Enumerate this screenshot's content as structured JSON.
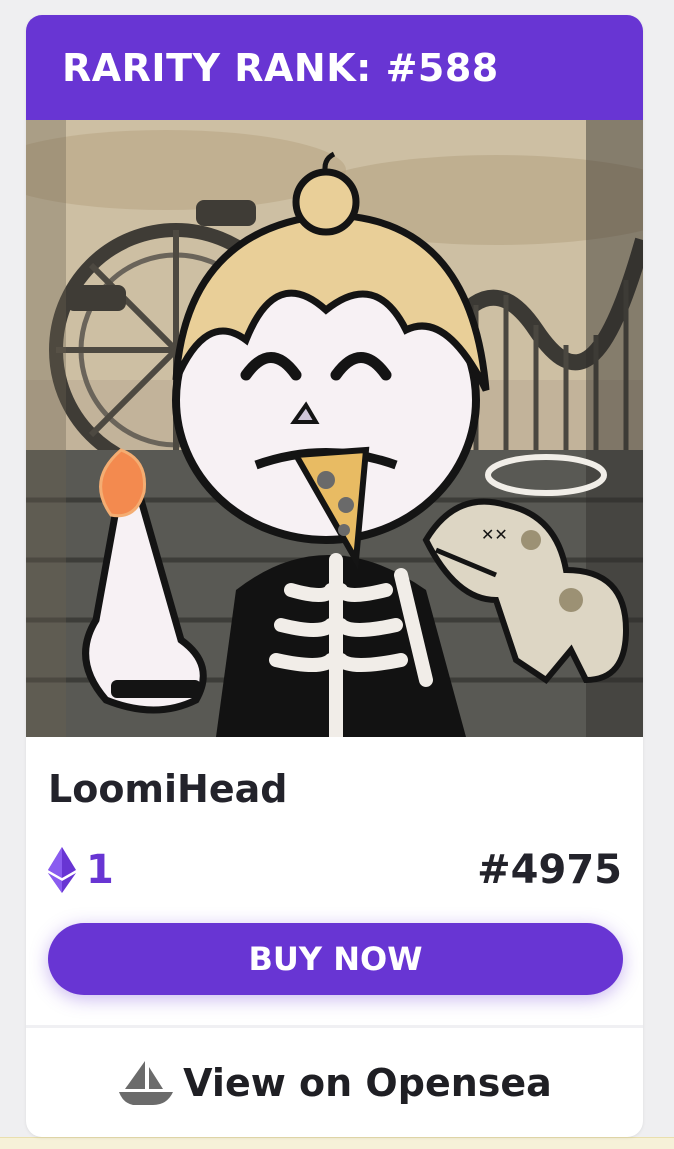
{
  "card": {
    "rarity_rank": "RARITY RANK: #588",
    "name": "LoomiHead",
    "price": "1",
    "token_id": "#4975",
    "buy_label": "BUY NOW",
    "opensea_label": "View on Opensea"
  },
  "icons": {
    "currency": "ethereum-icon",
    "marketplace": "opensea-ship-icon"
  },
  "colors": {
    "accent": "#6835d3",
    "text_dark": "#23232b"
  }
}
